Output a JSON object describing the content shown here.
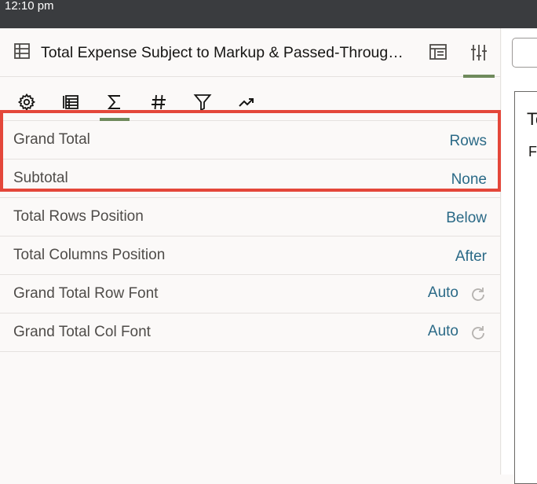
{
  "status_bar": {
    "time": "12:10 pm"
  },
  "panel": {
    "title": "Total Expense Subject to Markup & Passed-Throug…",
    "icons": {
      "table": "table-grid-icon",
      "layout": "layout-icon",
      "properties": "sliders-icon"
    }
  },
  "toolbar": {
    "tabs": [
      {
        "icon": "gear-icon",
        "active": false
      },
      {
        "icon": "table-rows-icon",
        "active": false
      },
      {
        "icon": "sigma-icon",
        "active": true
      },
      {
        "icon": "hash-icon",
        "active": false
      },
      {
        "icon": "filter-icon",
        "active": false
      },
      {
        "icon": "trend-icon",
        "active": false
      }
    ]
  },
  "properties": [
    {
      "label": "Grand Total",
      "value": "Rows"
    },
    {
      "label": "Subtotal",
      "value": "None"
    },
    {
      "label": "Total Rows Position",
      "value": "Below"
    },
    {
      "label": "Total Columns Position",
      "value": "After"
    },
    {
      "label": "Grand Total Row Font",
      "value": "Auto",
      "reset_icon": "reset-icon"
    },
    {
      "label": "Grand Total Col Font",
      "value": "Auto",
      "reset_icon": "reset-icon"
    }
  ],
  "canvas": {
    "text1": "To",
    "text2": "F"
  },
  "colors": {
    "accent": "#6f8a5c",
    "link_value": "#2b6a87",
    "highlight": "#e4473a",
    "status_bar": "#3a3c3f"
  }
}
